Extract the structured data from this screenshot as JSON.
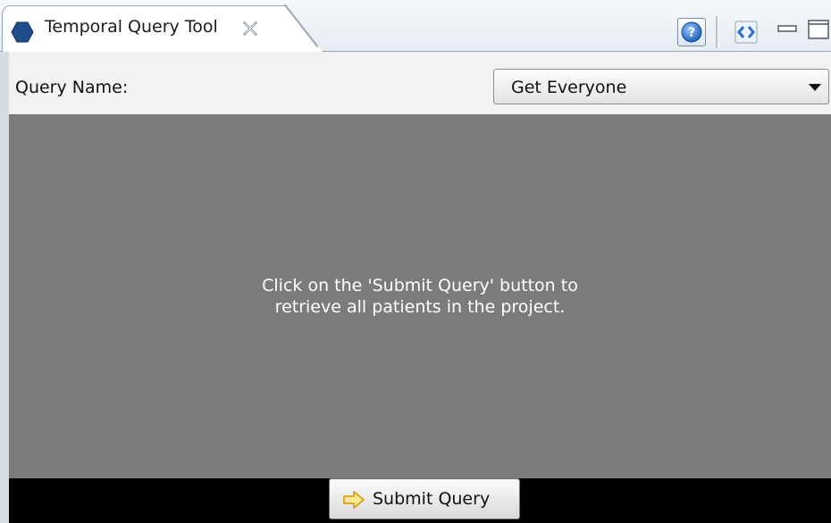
{
  "tab": {
    "title": "Temporal Query Tool",
    "icon": "hexagon-icon",
    "close_icon": "close-icon"
  },
  "toolbar": {
    "help_icon": "help-icon",
    "link_icon": "link-icon",
    "minimize_icon": "minimize-icon",
    "maximize_icon": "maximize-icon"
  },
  "query": {
    "label": "Query Name:",
    "selected": "Get Everyone"
  },
  "message": {
    "line1": "Click on the 'Submit Query' button to",
    "line2": "retrieve all patients in the project."
  },
  "submit": {
    "label": "Submit Query",
    "icon": "arrow-right-icon"
  },
  "colors": {
    "content_bg": "#7b7b7b",
    "bottom_bar_bg": "#000000",
    "tab_icon": "#1f4e8c",
    "arrow_icon": "#f0b429"
  }
}
